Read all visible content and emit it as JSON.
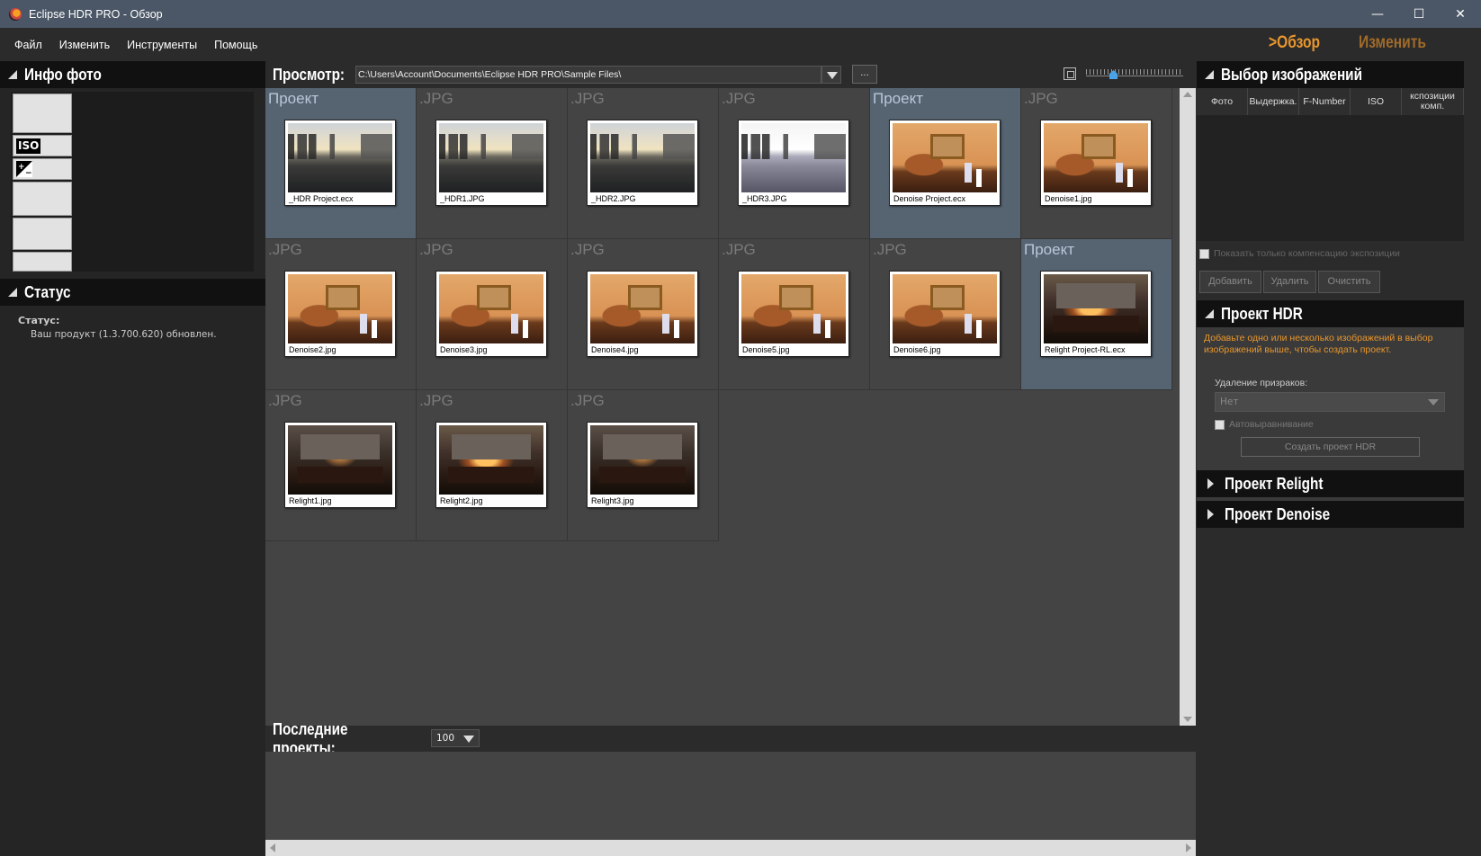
{
  "window": {
    "title": "Eclipse HDR PRO - Обзор",
    "minimize": "—",
    "maximize": "☐",
    "close": "✕"
  },
  "menu": {
    "items": [
      "Файл",
      "Изменить",
      "Инструменты",
      "Помощь"
    ],
    "mode_browse": ">Обзор",
    "mode_edit": "Изменить"
  },
  "left": {
    "photo_info_title": "Инфо фото",
    "iso_label": "ISO",
    "status_title": "Статус",
    "status_label": "Статус:",
    "status_text": "Ваш продукт (1.3.700.620) обновлен."
  },
  "browse": {
    "label": "Просмотр:",
    "path": "C:\\Users\\Account\\Documents\\Eclipse HDR PRO\\Sample Files\\",
    "browse_button": "..."
  },
  "tiles": [
    {
      "type": "Проект",
      "name": "_HDR Project.ecx",
      "kind": "city",
      "project": true
    },
    {
      "type": ".JPG",
      "name": "_HDR1.JPG",
      "kind": "city",
      "project": false
    },
    {
      "type": ".JPG",
      "name": "_HDR2.JPG",
      "kind": "city",
      "project": false
    },
    {
      "type": ".JPG",
      "name": "_HDR3.JPG",
      "kind": "city bright",
      "project": false
    },
    {
      "type": "Проект",
      "name": "Denoise Project.ecx",
      "kind": "still",
      "project": true
    },
    {
      "type": ".JPG",
      "name": "Denoise1.jpg",
      "kind": "still",
      "project": false
    },
    {
      "type": ".JPG",
      "name": "Denoise2.jpg",
      "kind": "still",
      "project": false
    },
    {
      "type": ".JPG",
      "name": "Denoise3.jpg",
      "kind": "still",
      "project": false
    },
    {
      "type": ".JPG",
      "name": "Denoise4.jpg",
      "kind": "still",
      "project": false
    },
    {
      "type": ".JPG",
      "name": "Denoise5.jpg",
      "kind": "still",
      "project": false
    },
    {
      "type": ".JPG",
      "name": "Denoise6.jpg",
      "kind": "still",
      "project": false
    },
    {
      "type": "Проект",
      "name": "Relight Project-RL.ecx",
      "kind": "fire lit",
      "project": true
    },
    {
      "type": ".JPG",
      "name": "Relight1.jpg",
      "kind": "fire",
      "project": false
    },
    {
      "type": ".JPG",
      "name": "Relight2.jpg",
      "kind": "fire lit",
      "project": false
    },
    {
      "type": ".JPG",
      "name": "Relight3.jpg",
      "kind": "fire",
      "project": false
    }
  ],
  "recent": {
    "label": "Последние проекты:",
    "count": "100"
  },
  "right": {
    "selection_title": "Выбор изображений",
    "columns": [
      "Фото",
      "Выдержка.",
      "F-Number",
      "ISO",
      "кспозиции комп."
    ],
    "show_comp_only": "Показать только компенсацию экспозиции",
    "add": "Добавить",
    "remove": "Удалить",
    "clear": "Очистить",
    "hdr_title": "Проект HDR",
    "hdr_hint": "Добавьте одно или несколько изображений в выбор изображений выше, чтобы создать проект.",
    "ghost_label": "Удаление призраков:",
    "ghost_value": "Нет",
    "auto_align": "Автовыравнивание",
    "create_hdr": "Создать проект HDR",
    "relight_title": "Проект Relight",
    "denoise_title": "Проект Denoise"
  },
  "colors": {
    "accent": "#e8962c",
    "titlebar": "#4b5766",
    "project_tile": "#566472"
  }
}
